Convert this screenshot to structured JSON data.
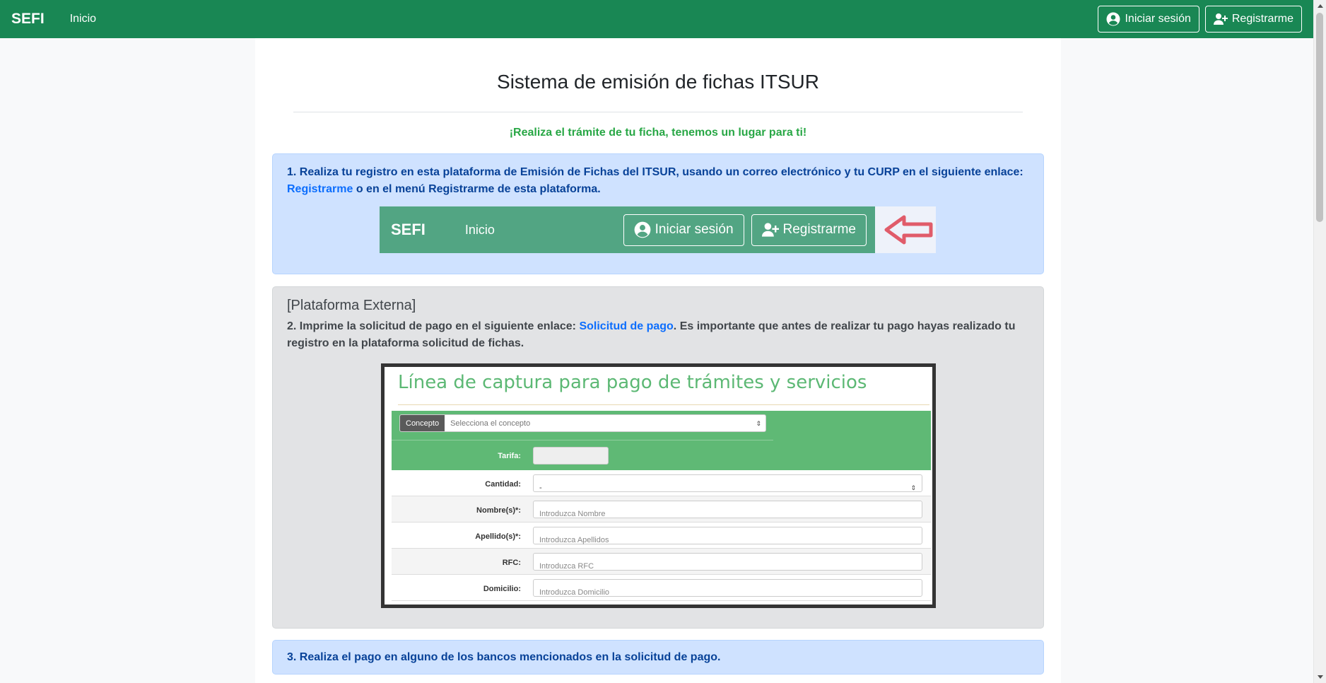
{
  "navbar": {
    "brand": "SEFI",
    "home_link": "Inicio",
    "login_button": "Iniciar sesión",
    "register_button": "Registrarme",
    "color": "#198754"
  },
  "main": {
    "title": "Sistema de emisión de fichas ITSUR",
    "slogan": "¡Realiza el trámite de tu ficha, tenemos un lugar para ti!",
    "step1": {
      "text_before_link": "1. Realiza tu registro en esta plataforma de Emisión de Fichas del ITSUR, usando un correo electrónico y tu CURP en el siguiente enlace: ",
      "link": "Registrarme",
      "text_after_link": " o en el menú Registrarme de esta plataforma.",
      "image": {
        "brand": "SEFI",
        "home_link": "Inicio",
        "login_button": "Iniciar sesión",
        "register_button": "Registrarme",
        "arrow_color": "#e05c6a"
      }
    },
    "step2": {
      "heading": "[Plataforma Externa]",
      "text_before_link": "2. Imprime la solicitud de pago en el siguiente enlace: ",
      "link": "Solicitud de pago",
      "text_after_link": ". Es importante que antes de realizar tu pago hayas realizado tu registro en la plataforma solicitud de fichas.",
      "image": {
        "title": "Línea de captura para pago de trámites y servicios",
        "concepto_label": "Concepto",
        "concepto_placeholder": "Selecciona el concepto",
        "tarifa_label": "Tarifa:",
        "fields": [
          {
            "label": "Cantidad:",
            "value": "-"
          },
          {
            "label": "Nombre(s)*:",
            "value": "Introduzca Nombre"
          },
          {
            "label": "Apellido(s)*:",
            "value": "Introduzca Apellidos"
          },
          {
            "label": "RFC:",
            "value": "Introduzca RFC"
          },
          {
            "label": "Domicilio:",
            "value": "Introduzca Domicilio"
          }
        ]
      }
    },
    "step3": {
      "text": "3. Realiza el pago en alguno de los bancos mencionados en la solicitud de pago."
    }
  }
}
